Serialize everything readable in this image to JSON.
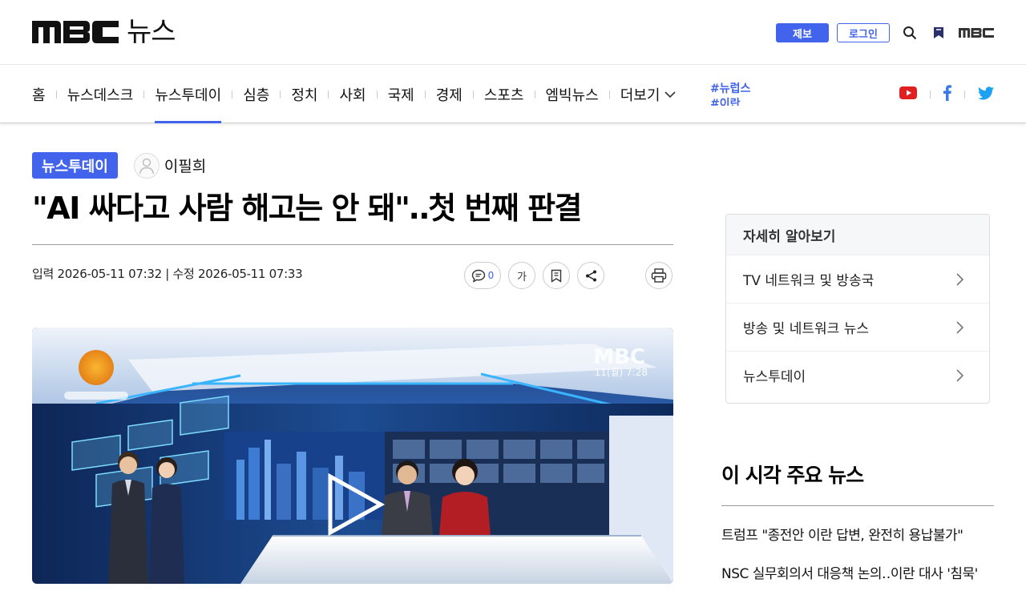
{
  "header": {
    "logo_text": "뉴스",
    "logo_mark": "MBC",
    "report_label": "제보",
    "login_label": "로그인",
    "mbc_small": "MBC"
  },
  "nav": {
    "items": [
      {
        "label": "홈"
      },
      {
        "label": "뉴스데스크"
      },
      {
        "label": "뉴스투데이"
      },
      {
        "label": "심층"
      },
      {
        "label": "정치"
      },
      {
        "label": "사회"
      },
      {
        "label": "국제"
      },
      {
        "label": "경제"
      },
      {
        "label": "스포츠"
      },
      {
        "label": "엠빅뉴스"
      }
    ],
    "more_label": "더보기",
    "hashtags": [
      "#뉴럽스",
      "#이란"
    ],
    "active_index": 2
  },
  "article": {
    "category": "뉴스투데이",
    "reporter": "이필희",
    "headline": "\"AI 싸다고 사람 해고는 안 돼\"‥첫 번째 판결",
    "dates": "입력 2026-05-11 07:32 | 수정 2026-05-11 07:33",
    "comment_count": "0",
    "font_tool_label": "가"
  },
  "video": {
    "channel_mark": "MBC",
    "timestamp": "11(월) 7:28"
  },
  "sidebar": {
    "box_title": "자세히 알아보기",
    "links": [
      {
        "label": "TV 네트워크 및 방송국"
      },
      {
        "label": "방송 및 네트워크 뉴스"
      },
      {
        "label": "뉴스투데이"
      }
    ],
    "news_title": "이 시각 주요 뉴스",
    "news": [
      {
        "label": "트럼프 \"종전안 이란 답변, 완전히 용납불가\""
      },
      {
        "label": "NSC 실무회의서 대응책 논의‥이란 대사 '침묵'"
      }
    ]
  },
  "colors": {
    "accent": "#4263eb",
    "youtube": "#e02020",
    "facebook": "#3b7be8",
    "twitter": "#1da1f2"
  }
}
